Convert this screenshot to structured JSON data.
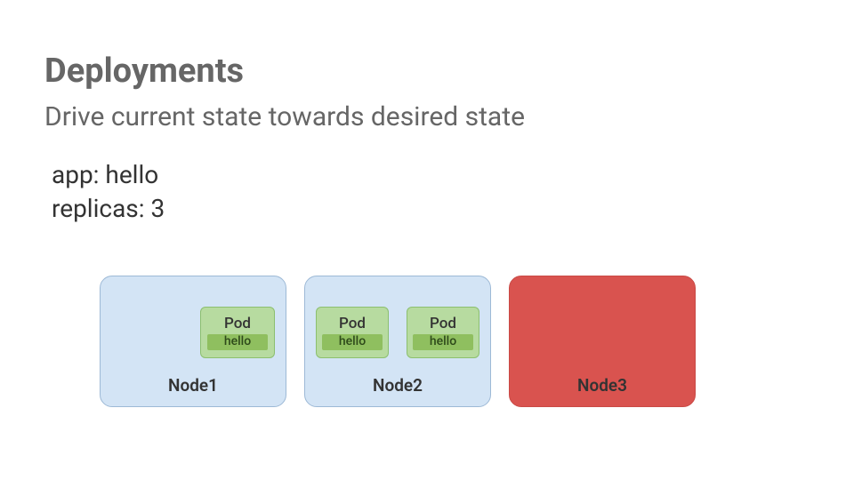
{
  "title": "Deployments",
  "subtitle": "Drive current state towards desired state",
  "config": {
    "app_line": "app: hello",
    "replicas_line": "replicas: 3"
  },
  "pod": {
    "label": "Pod",
    "app": "hello"
  },
  "nodes": [
    {
      "name": "Node1",
      "status": "healthy",
      "pods": 1
    },
    {
      "name": "Node2",
      "status": "healthy",
      "pods": 2
    },
    {
      "name": "Node3",
      "status": "failed",
      "pods": 0
    }
  ],
  "colors": {
    "node_healthy_bg": "#d3e4f5",
    "node_failed_bg": "#d9534f",
    "pod_bg": "#b7dba0",
    "pod_app_bg": "#8fbf5f"
  }
}
